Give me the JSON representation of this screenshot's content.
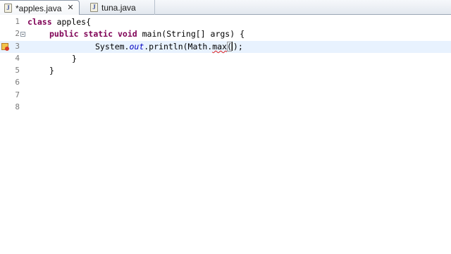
{
  "tabs": [
    {
      "label": "*apples.java",
      "close": "✕"
    },
    {
      "label": "tuna.java"
    }
  ],
  "editor": {
    "line_numbers": [
      "1",
      "2",
      "3",
      "4",
      "5",
      "6",
      "7",
      "8"
    ],
    "line1": {
      "kw": "class",
      "rest": " apples{"
    },
    "line2": {
      "kw1": "public",
      "kw2": "static",
      "kw3": "void",
      "rest": " main(String[] args) {"
    },
    "line3": {
      "pre": "System.",
      "field": "out",
      "mid": ".println(Math.",
      "method": "max",
      "open": "(",
      "close": ");"
    },
    "line4": "}",
    "line5": "}"
  },
  "icons": {
    "tab_file": "java-file-icon",
    "error_marker": "error-quickfix-icon",
    "fold": "fold-collapse-icon"
  },
  "colors": {
    "keyword": "#7f0055",
    "field": "#0000c0",
    "current_line": "#e8f2fe",
    "error": "#e02020"
  }
}
